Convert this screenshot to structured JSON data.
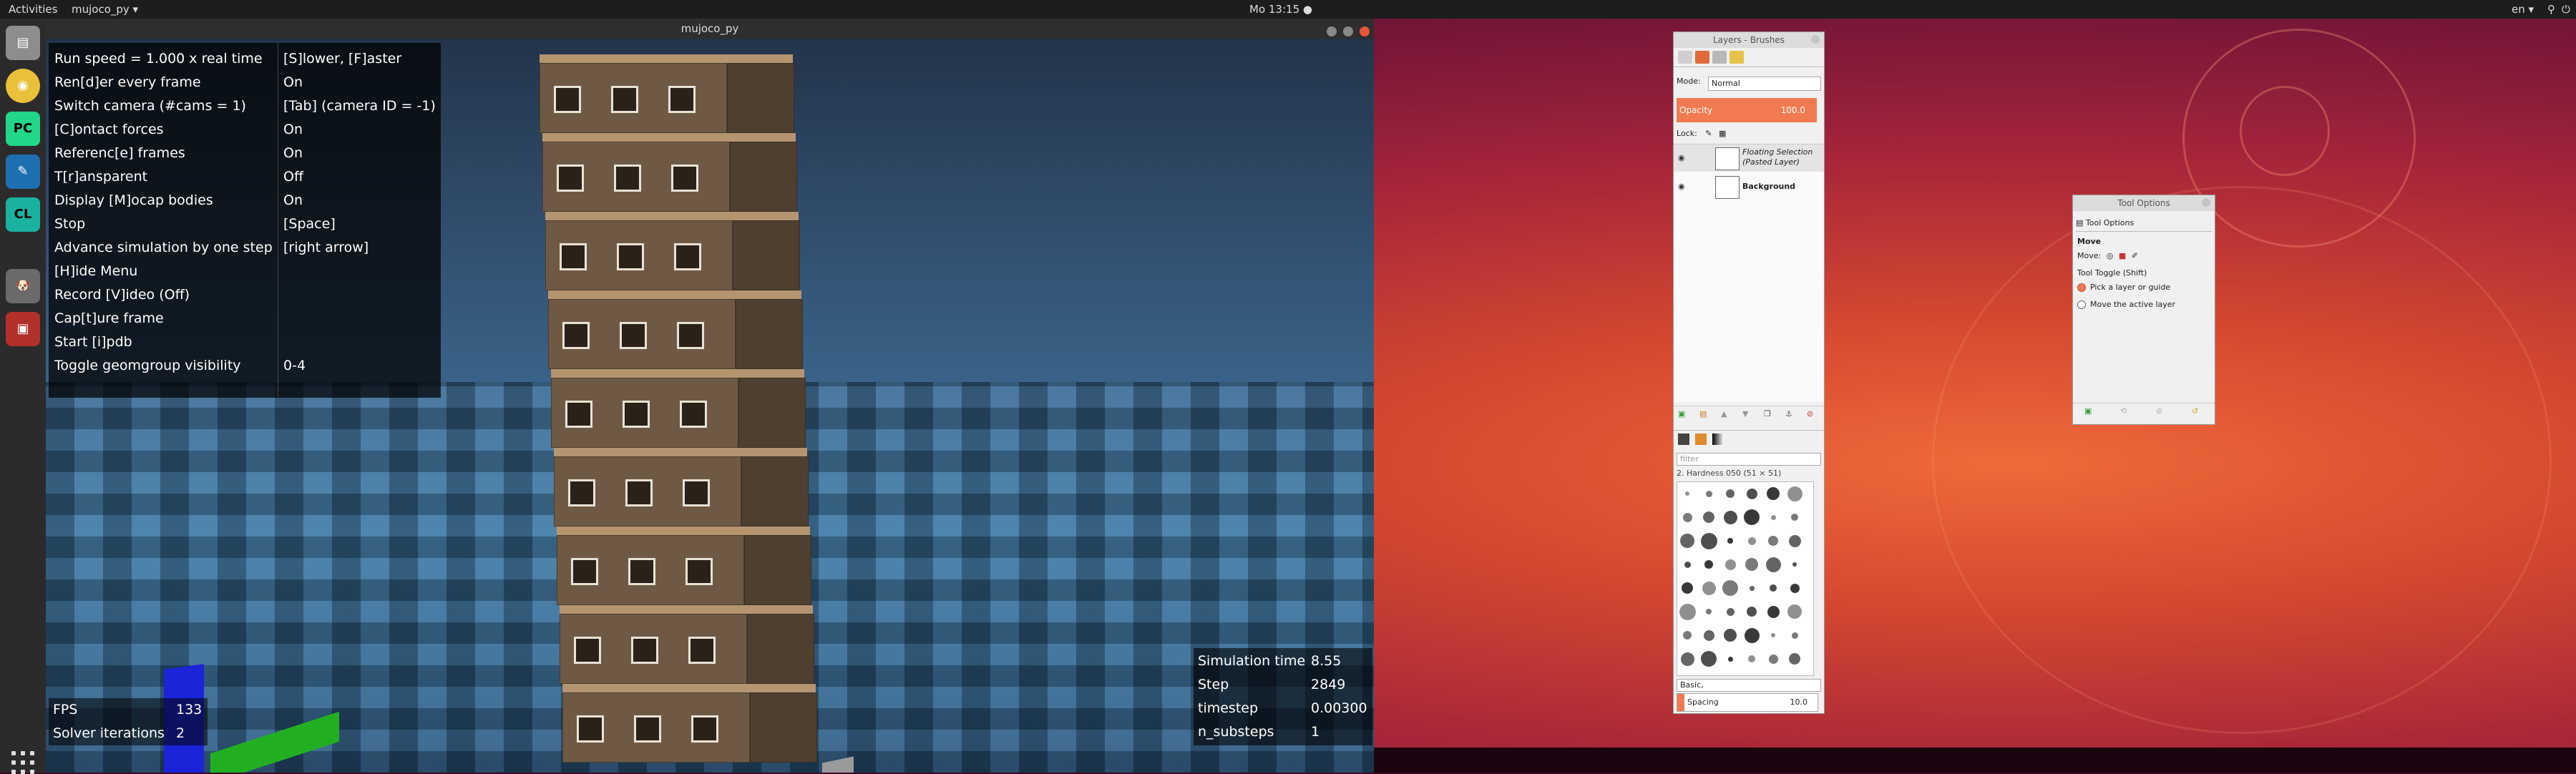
{
  "topbar": {
    "activities": "Activities",
    "app_menu": "mujoco_py ▾",
    "clock": "Mo 13:15 ●",
    "lang": "en ▾",
    "tray_icons": [
      "accessibility-icon",
      "network-icon",
      "volume-icon",
      "power-icon"
    ]
  },
  "dock": {
    "items": [
      {
        "icon": "files-icon",
        "color": "#8d8d8d"
      },
      {
        "icon": "chrome-icon",
        "color": "#e9c03a"
      },
      {
        "icon": "pycharm-icon",
        "label": "PC",
        "color": "#21d789"
      },
      {
        "icon": "inkscape-icon",
        "color": "#1e6fb0"
      },
      {
        "icon": "clion-icon",
        "label": "CL",
        "color": "#19b2a0"
      },
      {
        "icon": "gimp-icon",
        "color": "#6a6a6a"
      },
      {
        "icon": "screenshot-app-icon",
        "color": "#b2302a"
      }
    ]
  },
  "mujoco": {
    "window_title": "mujoco_py",
    "menu": [
      {
        "key": "Run speed = 1.000 x real time",
        "value": "[S]lower, [F]aster"
      },
      {
        "key": "Ren[d]er every frame",
        "value": "On"
      },
      {
        "key": "Switch camera (#cams = 1)",
        "value": "[Tab] (camera ID = -1)"
      },
      {
        "key": "[C]ontact forces",
        "value": "On"
      },
      {
        "key": "Referenc[e] frames",
        "value": "On"
      },
      {
        "key": "T[r]ansparent",
        "value": "Off"
      },
      {
        "key": "Display [M]ocap bodies",
        "value": "On"
      },
      {
        "key": "Stop",
        "value": "[Space]"
      },
      {
        "key": "Advance simulation by one step",
        "value": "[right arrow]"
      },
      {
        "key": "[H]ide Menu",
        "value": ""
      },
      {
        "key": "Record [V]ideo (Off)",
        "value": ""
      },
      {
        "key": "Cap[t]ure frame",
        "value": ""
      },
      {
        "key": "Start [i]pdb",
        "value": ""
      },
      {
        "key": "Toggle geomgroup visibility",
        "value": "0-4"
      }
    ],
    "fps": [
      {
        "key": "FPS",
        "value": "133"
      },
      {
        "key": "Solver iterations",
        "value": "2"
      }
    ],
    "sim": [
      {
        "key": "Simulation time",
        "value": "8.55"
      },
      {
        "key": "Step",
        "value": "2849"
      },
      {
        "key": "timestep",
        "value": "0.00300"
      },
      {
        "key": "n_substeps",
        "value": "1"
      }
    ]
  },
  "gimp_layers": {
    "title": "Layers - Brushes",
    "mode_label": "Mode:",
    "mode_value": "Normal",
    "opacity_label": "Opacity",
    "opacity_value": "100.0",
    "lock_label": "Lock:",
    "layers": [
      {
        "name": "Floating Selection (Pasted Layer)"
      },
      {
        "name": "Background"
      }
    ],
    "filter_placeholder": "filter",
    "brush_name": "2. Hardness 050 (51 × 51)",
    "brush_set": "Basic,",
    "spacing_label": "Spacing",
    "spacing_value": "10.0",
    "accent": "#f27a50"
  },
  "tool_options": {
    "title": "Tool Options",
    "tab_label": "Tool Options",
    "tool_name": "Move",
    "move_label": "Move:",
    "toggle_label": "Tool Toggle  (Shift)",
    "options": [
      {
        "label": "Pick a layer or guide",
        "selected": true
      },
      {
        "label": "Move the active layer",
        "selected": false
      }
    ]
  }
}
